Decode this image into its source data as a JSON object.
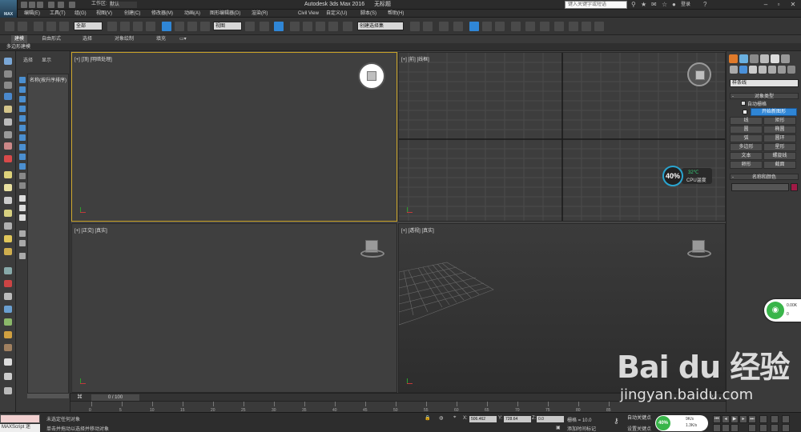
{
  "titlebar": {
    "logo_text": "MAX",
    "workspace_label": "工作区:",
    "workspace_value": "默认",
    "title": "Autodesk 3ds Max 2016",
    "doc_name": "无标题",
    "search_placeholder": "键入关键字或短语",
    "login": "登录"
  },
  "menubar": {
    "items": [
      "编辑(E)",
      "工具(T)",
      "组(G)",
      "视图(V)",
      "创建(C)",
      "修改器(M)",
      "动画(A)",
      "图形编辑器(D)",
      "渲染(R)",
      "Civil View",
      "自定义(U)",
      "脚本(S)",
      "帮助(H)"
    ]
  },
  "toolbar": {
    "selection_filter": "全部",
    "ref_coord": "视图",
    "named_selection": "创建选择集"
  },
  "ribbon": {
    "tabs": [
      "建模",
      "自由形式",
      "选择",
      "对象绘制",
      "填充"
    ],
    "sub_label": "多边形建模"
  },
  "scene_explorer": {
    "tab_select": "选择",
    "tab_display": "显示",
    "header": "名称(按升序排序)",
    "footer": ""
  },
  "viewports": {
    "top": "[+] [顶] [明暗处理]",
    "front": "[+] [前] [线框]",
    "left": "[+] [正交] [真实]",
    "persp": "[+] [透视] [真实]"
  },
  "command_panel": {
    "category": "样条线",
    "object_type_title": "对象类型",
    "auto_grid": "自动栅格",
    "start_new_shape": "开始新图形",
    "buttons": [
      "线",
      "矩形",
      "圆",
      "椭圆",
      "弧",
      "圆环",
      "多边形",
      "星形",
      "文本",
      "螺旋线",
      "卵形",
      "截面"
    ],
    "name_color_title": "名称和颜色",
    "swatch_color": "#a01a46"
  },
  "cpu_widget": {
    "percent": "40%",
    "temperature": "32℃",
    "label": "CPU温度"
  },
  "wifi_widget": {
    "up": "0.00K",
    "down": "0"
  },
  "timeline": {
    "slider": "0 / 100",
    "ticks": [
      "0",
      "5",
      "10",
      "15",
      "20",
      "25",
      "30",
      "35",
      "40",
      "45",
      "50",
      "55",
      "60",
      "65",
      "70",
      "75",
      "80",
      "85"
    ]
  },
  "statusbar": {
    "maxscript": "MAXScript 迷",
    "status1": "未选定任何对象",
    "status2": "单击并拖动以选择并移动对象",
    "x_label": "X:",
    "x_value": "506.462",
    "y_label": "Y:",
    "y_value": "728.64",
    "z_label": "Z:",
    "z_value": "0.0",
    "grid": "栅格 = 10.0",
    "auto_key": "自动关键点",
    "set_key": "设置关键点",
    "add_time_tag": "添加时间标记",
    "net_percent": "40%",
    "net_up": "9K/s",
    "net_down": "1.3K/s"
  },
  "watermark": {
    "brand": "Bai du 经验",
    "url": "jingyan.baidu.com"
  }
}
